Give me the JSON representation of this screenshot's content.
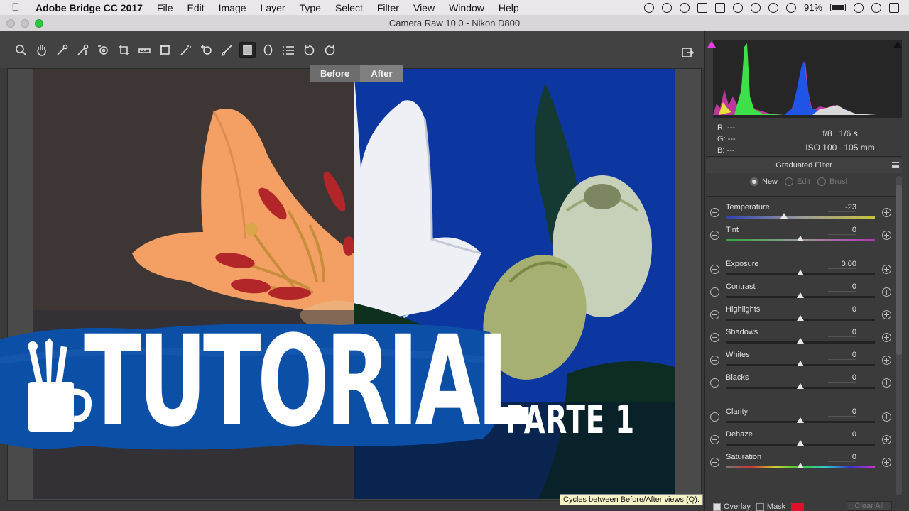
{
  "menubar": {
    "app": "Adobe Bridge CC 2017",
    "items": [
      "File",
      "Edit",
      "Image",
      "Layer",
      "Type",
      "Select",
      "Filter",
      "View",
      "Window",
      "Help"
    ],
    "battery": "91%"
  },
  "window": {
    "title": "Camera Raw 10.0  -  Nikon D800"
  },
  "view_tabs": {
    "before": "Before",
    "after": "After"
  },
  "banner": {
    "title": "TUTORIAL",
    "subtitle": "PARTE 1"
  },
  "info": {
    "r": "R:   ---",
    "g": "G:   ---",
    "b": "B:   ---",
    "aperture": "f/8",
    "shutter": "1/6 s",
    "iso": "ISO 100",
    "focal": "105 mm"
  },
  "panel": {
    "title": "Graduated Filter",
    "modes": {
      "new": "New",
      "edit": "Edit",
      "brush": "Brush"
    }
  },
  "sliders": [
    {
      "label": "Temperature",
      "value": "-23",
      "pos": 0.39,
      "track": "temp"
    },
    {
      "label": "Tint",
      "value": "0",
      "pos": 0.5,
      "track": "tint"
    },
    {
      "label": "Exposure",
      "value": "0.00",
      "pos": 0.5,
      "track": ""
    },
    {
      "label": "Contrast",
      "value": "0",
      "pos": 0.5,
      "track": ""
    },
    {
      "label": "Highlights",
      "value": "0",
      "pos": 0.5,
      "track": ""
    },
    {
      "label": "Shadows",
      "value": "0",
      "pos": 0.5,
      "track": ""
    },
    {
      "label": "Whites",
      "value": "0",
      "pos": 0.5,
      "track": ""
    },
    {
      "label": "Blacks",
      "value": "0",
      "pos": 0.5,
      "track": ""
    },
    {
      "label": "Clarity",
      "value": "0",
      "pos": 0.5,
      "track": ""
    },
    {
      "label": "Dehaze",
      "value": "0",
      "pos": 0.5,
      "track": ""
    },
    {
      "label": "Saturation",
      "value": "0",
      "pos": 0.5,
      "track": "sat"
    }
  ],
  "tooltip": "Cycles between Before/After views (Q).",
  "bottom": {
    "overlay": "Overlay",
    "mask": "Mask",
    "clear_all": "Clear All"
  },
  "colors": {
    "after_bg": "#0c36a0",
    "banner_blue": "#0b4fa6",
    "mask": "#e0102a"
  }
}
